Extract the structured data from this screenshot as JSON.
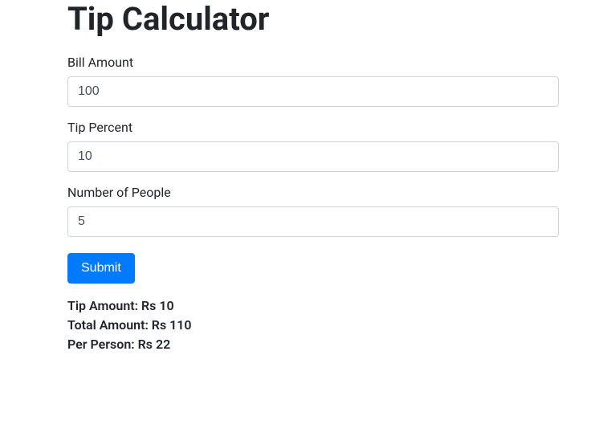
{
  "title": "Tip Calculator",
  "form": {
    "bill": {
      "label": "Bill Amount",
      "value": "100"
    },
    "tip": {
      "label": "Tip Percent",
      "value": "10"
    },
    "people": {
      "label": "Number of People",
      "value": "5"
    },
    "submit_label": "Submit"
  },
  "results": {
    "tip_amount": "Tip Amount: Rs 10",
    "total_amount": "Total Amount: Rs 110",
    "per_person": "Per Person: Rs 22"
  }
}
